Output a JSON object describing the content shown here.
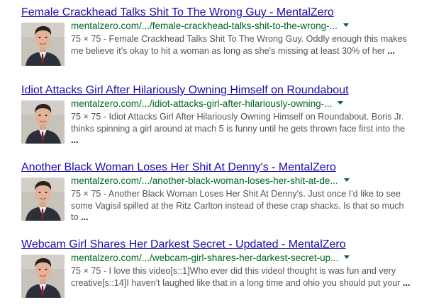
{
  "results": [
    {
      "title": "Female Crackhead Talks Shit To The Wrong Guy - MentalZero",
      "url": "mentalzero.com/.../female-crackhead-talks-shit-to-the-wrong-...",
      "snippet": "75 × 75 - Female Crackhead Talks Shit To The Wrong Guy. Oddly enough this makes me believe it's okay to hit a woman as long as she's missing at least 30% of her",
      "ellipsis": "..."
    },
    {
      "title": "Idiot Attacks Girl After Hilariously Owning Himself on Roundabout",
      "url": "mentalzero.com/.../idiot-attacks-girl-after-hilariously-owning-...",
      "snippet": "75 × 75 - Idiot Attacks Girl After Hilariously Owning Himself on Roundabout. Boris Jr. thinks spinning a girl around at mach 5 is funny until he gets thrown face first into the",
      "ellipsis": "..."
    },
    {
      "title": "Another Black Woman Loses Her Shit At Denny's - MentalZero",
      "url": "mentalzero.com/.../another-black-woman-loses-her-shit-at-de...",
      "snippet": "75 × 75 - Another Black Woman Loses Her Shit At Denny's. Just once I'd like to see some Vagisil spilled at the Ritz Carlton instead of these crap shacks. Is that so much to",
      "ellipsis": "..."
    },
    {
      "title": "Webcam Girl Shares Her Darkest Secret - Updated - MentalZero",
      "url": "mentalzero.com/.../webcam-girl-shares-her-darkest-secret-up...",
      "snippet": "75 × 75 - I love this video[s::1]Who ever did this videol thought is was fun and very creative[s::14]I haven't laughed like that in a long time and ohio you should put your",
      "ellipsis": "..."
    }
  ]
}
